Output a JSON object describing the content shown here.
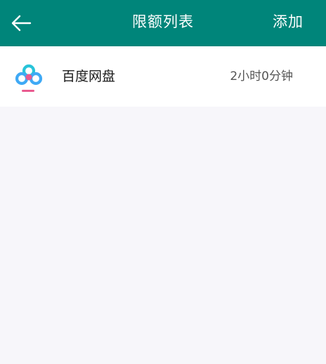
{
  "colors": {
    "appbar": "#00857a",
    "background": "#f7f6fa",
    "list_background": "#ffffff",
    "icon_blue": "#3fa9f5",
    "icon_pink": "#e95a8f",
    "icon_cyan": "#28c4d9"
  },
  "header": {
    "back_icon": "arrow-left-icon",
    "title": "限额列表",
    "add_label": "添加"
  },
  "limits": {
    "items": [
      {
        "icon": "baidu-netdisk-icon",
        "app_name": "百度网盘",
        "limit": "2小时0分钟"
      }
    ]
  }
}
